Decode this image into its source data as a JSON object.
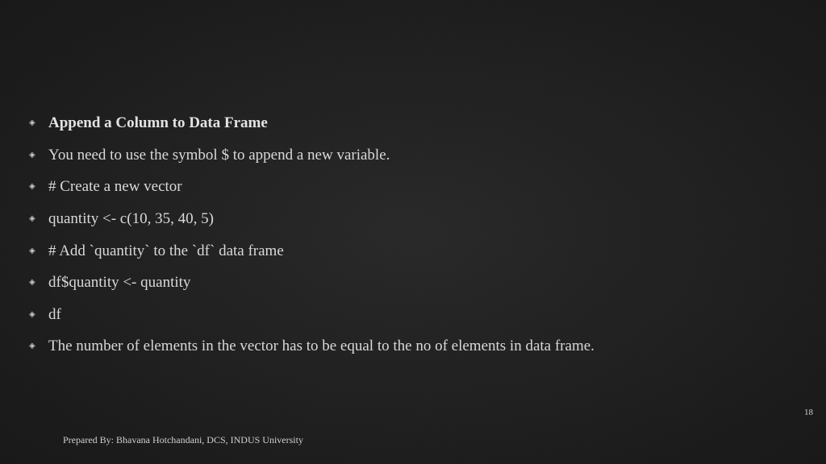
{
  "bullets": [
    {
      "text": "Append a Column to Data Frame",
      "bold": true
    },
    {
      "text": "You need to use the symbol $ to append a new variable.",
      "bold": false
    },
    {
      "text": "# Create a new vector",
      "bold": false
    },
    {
      "text": "quantity <- c(10, 35, 40, 5)",
      "bold": false
    },
    {
      "text": "# Add `quantity` to the `df` data frame",
      "bold": false
    },
    {
      "text": "df$quantity <- quantity",
      "bold": false
    },
    {
      "text": "df",
      "bold": false
    },
    {
      "text": "The number of elements in the vector has to be equal to the no of elements in data frame.",
      "bold": false
    }
  ],
  "page_number": "18",
  "footer": "Prepared By: Bhavana Hotchandani, DCS, INDUS University",
  "bullet_glyph": "◈"
}
